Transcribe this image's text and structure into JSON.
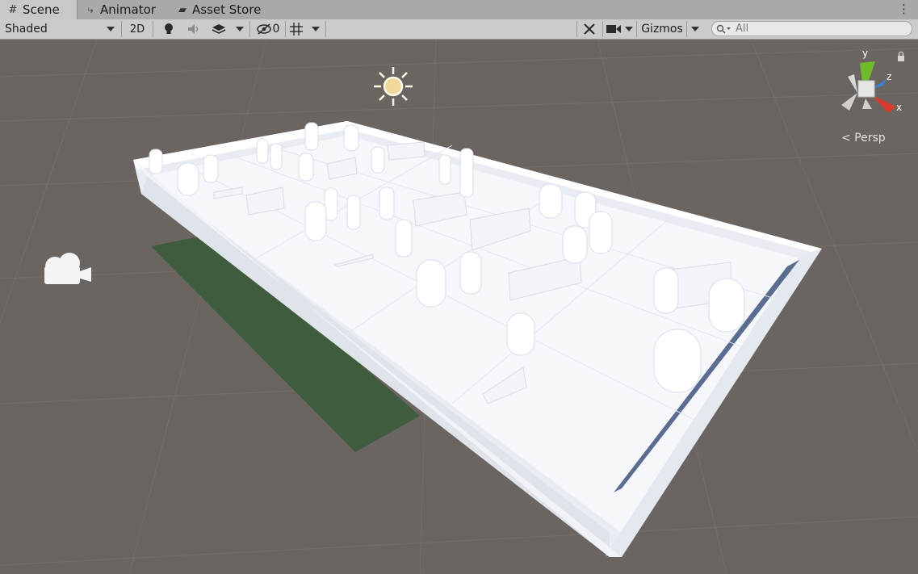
{
  "tabs": [
    {
      "label": "Scene",
      "icon": "grid-icon",
      "active": true
    },
    {
      "label": "Animator",
      "icon": "animator-icon",
      "active": false
    },
    {
      "label": "Asset Store",
      "icon": "store-bag-icon",
      "active": false
    }
  ],
  "toolbar": {
    "draw_mode": "Shaded",
    "mode_2d_label": "2D",
    "hidden_count": "0",
    "gizmos_label": "Gizmos",
    "search_placeholder": "All"
  },
  "scene_gizmo": {
    "axis_x": "x",
    "axis_y": "y",
    "axis_z": "z",
    "projection_label": "< Persp"
  },
  "colors": {
    "viewport_bg": "#6b6562",
    "floor": "#f4f6fb",
    "ground_plane": "#3f5c3e",
    "axis_x": "#d83a2e",
    "axis_y": "#7ec43a",
    "axis_z": "#3d7fd8"
  }
}
